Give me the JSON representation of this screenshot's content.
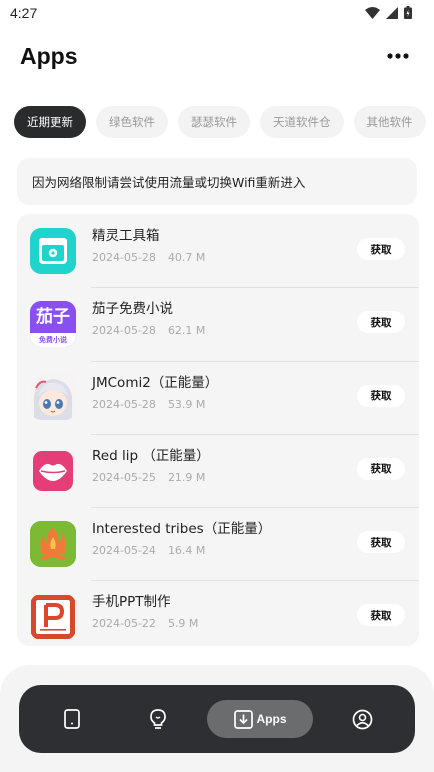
{
  "status_bar": {
    "time": "4:27",
    "icons": [
      "wifi-icon",
      "signal-icon",
      "battery-icon"
    ]
  },
  "header": {
    "title": "Apps",
    "more_icon": "more-horizontal-icon"
  },
  "tabs": [
    {
      "label": "近期更新",
      "active": true
    },
    {
      "label": "绿色软件",
      "active": false
    },
    {
      "label": "瑟瑟软件",
      "active": false
    },
    {
      "label": "天道软件仓",
      "active": false
    },
    {
      "label": "其他软件",
      "active": false
    }
  ],
  "notice": {
    "text": "因为网络限制请尝试使用流量或切换Wifi重新进入"
  },
  "apps": [
    {
      "name": "精灵工具箱",
      "date": "2024-05-28",
      "size": "40.7 M",
      "button": "获取",
      "icon": "toolbox-icon"
    },
    {
      "name": "茄子免费小说",
      "date": "2024-05-28",
      "size": "62.1 M",
      "button": "获取",
      "icon": "novel-app-icon",
      "icon_text": "茄子",
      "icon_subtext": "免费小说"
    },
    {
      "name": "JMComi2（正能量）",
      "date": "2024-05-28",
      "size": "53.9 M",
      "button": "获取",
      "icon": "anime-girl-icon"
    },
    {
      "name": "Red lip （正能量）",
      "date": "2024-05-25",
      "size": "21.9 M",
      "button": "获取",
      "icon": "lips-icon"
    },
    {
      "name": "Interested tribes（正能量）",
      "date": "2024-05-24",
      "size": "16.4 M",
      "button": "获取",
      "icon": "campfire-icon"
    },
    {
      "name": "手机PPT制作",
      "date": "2024-05-22",
      "size": "5.9 M",
      "button": "获取",
      "icon": "ppt-icon"
    }
  ],
  "bottom_nav": {
    "items": [
      {
        "id": "phone",
        "icon": "phone-icon"
      },
      {
        "id": "ideas",
        "icon": "lightbulb-icon"
      },
      {
        "id": "apps",
        "icon": "download-box-icon",
        "label": "Apps",
        "active": true
      },
      {
        "id": "profile",
        "icon": "user-circle-icon"
      }
    ]
  },
  "colors": {
    "active_tab": "#2a2b2d",
    "nav_bg": "#2e2f32",
    "nav_active": "#6b6c6e",
    "card_bg": "#f5f5f5"
  }
}
